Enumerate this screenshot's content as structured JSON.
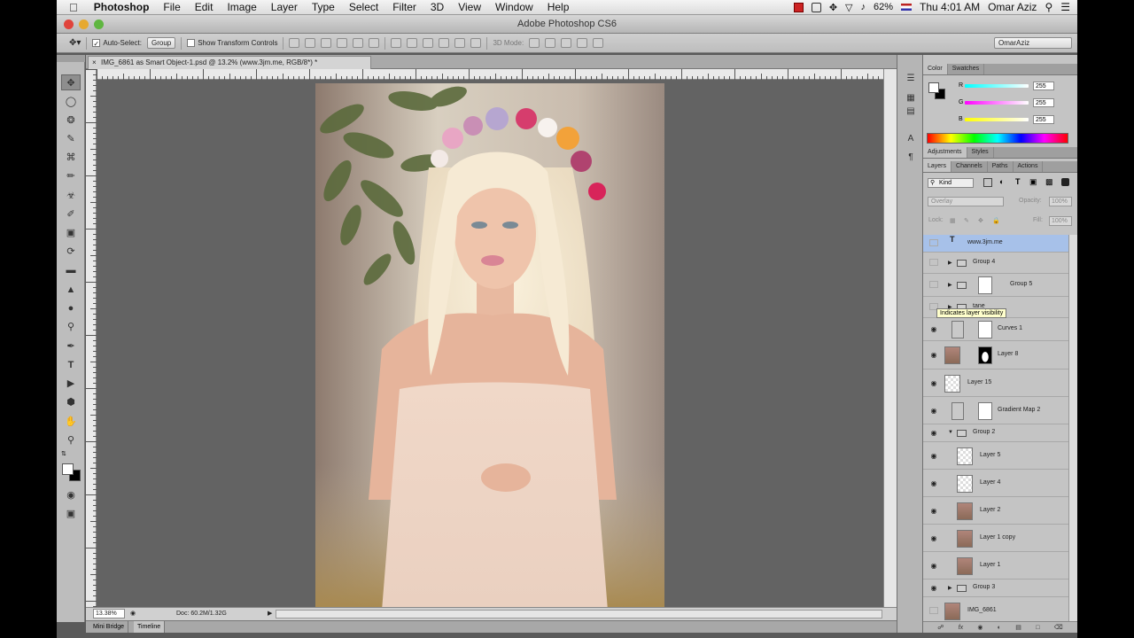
{
  "menubar": {
    "app": "Photoshop",
    "items": [
      "File",
      "Edit",
      "Image",
      "Layer",
      "Type",
      "Select",
      "Filter",
      "3D",
      "View",
      "Window",
      "Help"
    ],
    "battery": "62%",
    "clock": "Thu 4:01 AM",
    "user": "Omar Aziz"
  },
  "window": {
    "title": "Adobe Photoshop CS6"
  },
  "options": {
    "auto_select_label": "Auto-Select:",
    "auto_select_value": "Group",
    "transform_label": "Show Transform Controls",
    "mode_label": "3D Mode:",
    "workspace": "OmarAziz"
  },
  "document": {
    "tab_title": "IMG_6861 as Smart Object-1.psd @ 13.2% (www.3jm.me, RGB/8*) *",
    "zoom": "13.38%",
    "doc_size": "Doc: 60.2M/1.32G"
  },
  "bottom_tabs": [
    "Mini Bridge",
    "Timeline"
  ],
  "panels": {
    "color_tabs": [
      "Color",
      "Swatches"
    ],
    "color_r": "255",
    "color_g": "255",
    "color_b": "255",
    "adjust_tabs": [
      "Adjustments",
      "Styles"
    ],
    "layer_tabs": [
      "Layers",
      "Channels",
      "Paths",
      "Actions"
    ],
    "kind_filter": "Kind",
    "blend_mode": "Overlay",
    "opacity_label": "Opacity:",
    "opacity_value": "100%",
    "lock_label": "Lock:",
    "fill_label": "Fill:",
    "fill_value": "100%"
  },
  "tooltip": "Indicates layer visibility",
  "layers": [
    {
      "name": "www.3jm.me",
      "visible": false,
      "type": "text",
      "selected": true
    },
    {
      "name": "Group 4",
      "visible": false,
      "type": "group"
    },
    {
      "name": "Group 5",
      "visible": false,
      "type": "group-mask"
    },
    {
      "name": "tane",
      "visible": false,
      "type": "group"
    },
    {
      "name": "Curves 1",
      "visible": true,
      "type": "adjust"
    },
    {
      "name": "Layer 8",
      "visible": true,
      "type": "masked-photo"
    },
    {
      "name": "Layer 15",
      "visible": true,
      "type": "empty"
    },
    {
      "name": "Gradient Map 2",
      "visible": true,
      "type": "adjust"
    },
    {
      "name": "Group 2",
      "visible": true,
      "type": "group-open"
    },
    {
      "name": "Layer 5",
      "visible": true,
      "type": "child-empty"
    },
    {
      "name": "Layer 4",
      "visible": true,
      "type": "child-empty"
    },
    {
      "name": "Layer 2",
      "visible": true,
      "type": "child-photo"
    },
    {
      "name": "Layer 1 copy",
      "visible": true,
      "type": "child-photo"
    },
    {
      "name": "Layer 1",
      "visible": true,
      "type": "child-photo"
    },
    {
      "name": "Group 3",
      "visible": true,
      "type": "group"
    },
    {
      "name": "IMG_6861",
      "visible": false,
      "type": "photo"
    }
  ],
  "colors": {
    "accent_select": "#a7c1e9",
    "canvas_bg": "#636363"
  }
}
